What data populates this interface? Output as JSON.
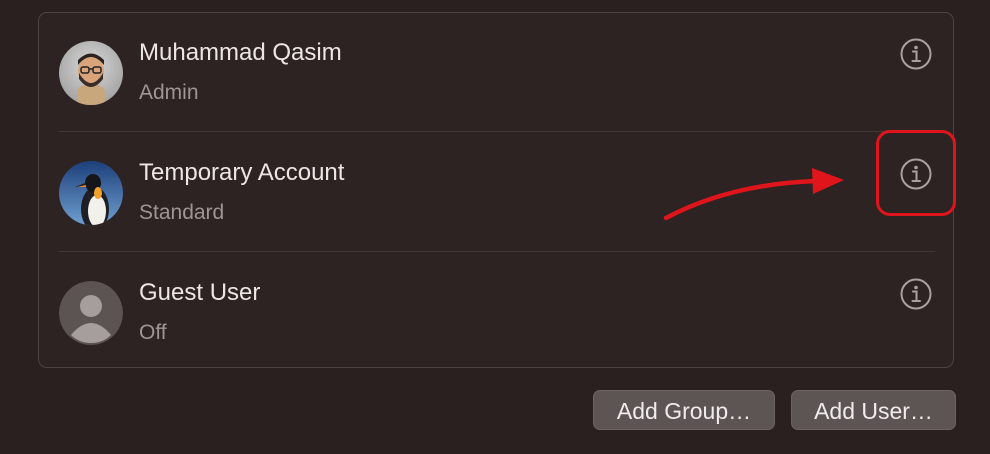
{
  "users": [
    {
      "name": "Muhammad Qasim",
      "role": "Admin",
      "avatar_icon": "memoji-avatar-icon"
    },
    {
      "name": "Temporary Account",
      "role": "Standard",
      "avatar_icon": "penguin-avatar-icon"
    },
    {
      "name": "Guest User",
      "role": "Off",
      "avatar_icon": "generic-person-avatar-icon"
    }
  ],
  "info_icon": "info-circle-icon",
  "buttons": {
    "add_group": "Add Group…",
    "add_user": "Add User…"
  },
  "annotation": {
    "color": "#e0151b",
    "target": "Temporary Account info button"
  }
}
